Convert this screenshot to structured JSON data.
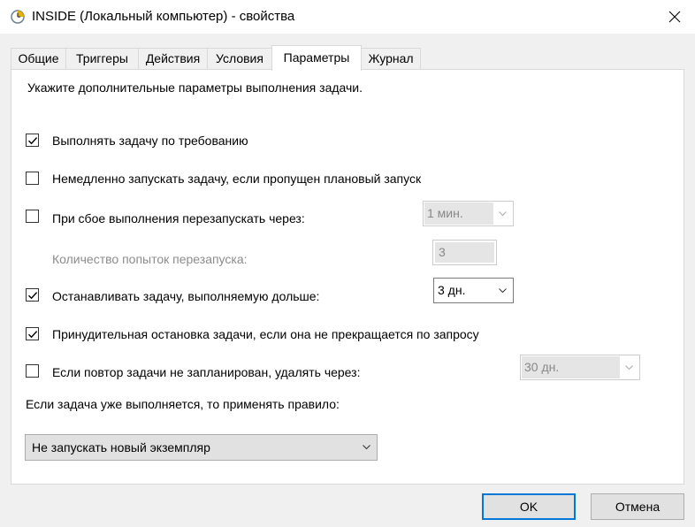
{
  "window": {
    "title": "INSIDE (Локальный компьютер) - свойства"
  },
  "tabs": [
    {
      "label": "Общие",
      "active": false
    },
    {
      "label": "Триггеры",
      "active": false
    },
    {
      "label": "Действия",
      "active": false
    },
    {
      "label": "Условия",
      "active": false
    },
    {
      "label": "Параметры",
      "active": true
    },
    {
      "label": "Журнал",
      "active": false
    }
  ],
  "settings": {
    "description": "Укажите дополнительные параметры выполнения задачи.",
    "run_on_demand": {
      "label": "Выполнять задачу по требованию",
      "checked": true
    },
    "run_missed": {
      "label": "Немедленно запускать задачу, если пропущен плановый запуск",
      "checked": false
    },
    "restart_on_failure": {
      "label": "При сбое выполнения перезапускать через:",
      "checked": false,
      "interval": "1 мин."
    },
    "restart_attempts": {
      "label": "Количество попыток перезапуска:",
      "value": "3"
    },
    "stop_if_longer": {
      "label": "Останавливать задачу, выполняемую дольше:",
      "checked": true,
      "duration": "3 дн."
    },
    "force_stop": {
      "label": "Принудительная остановка задачи, если она не прекращается по запросу",
      "checked": true
    },
    "delete_if_not_scheduled": {
      "label": "Если повтор задачи не запланирован, удалять через:",
      "checked": false,
      "duration": "30 дн."
    },
    "running_rule": {
      "label": "Если задача уже выполняется, то применять правило:",
      "value": "Не запускать новый экземпляр"
    }
  },
  "buttons": {
    "ok": "OK",
    "cancel": "Отмена"
  },
  "colors": {
    "accent": "#0078d7",
    "window_bg": "#f0f0f0",
    "panel_bg": "#ffffff"
  }
}
